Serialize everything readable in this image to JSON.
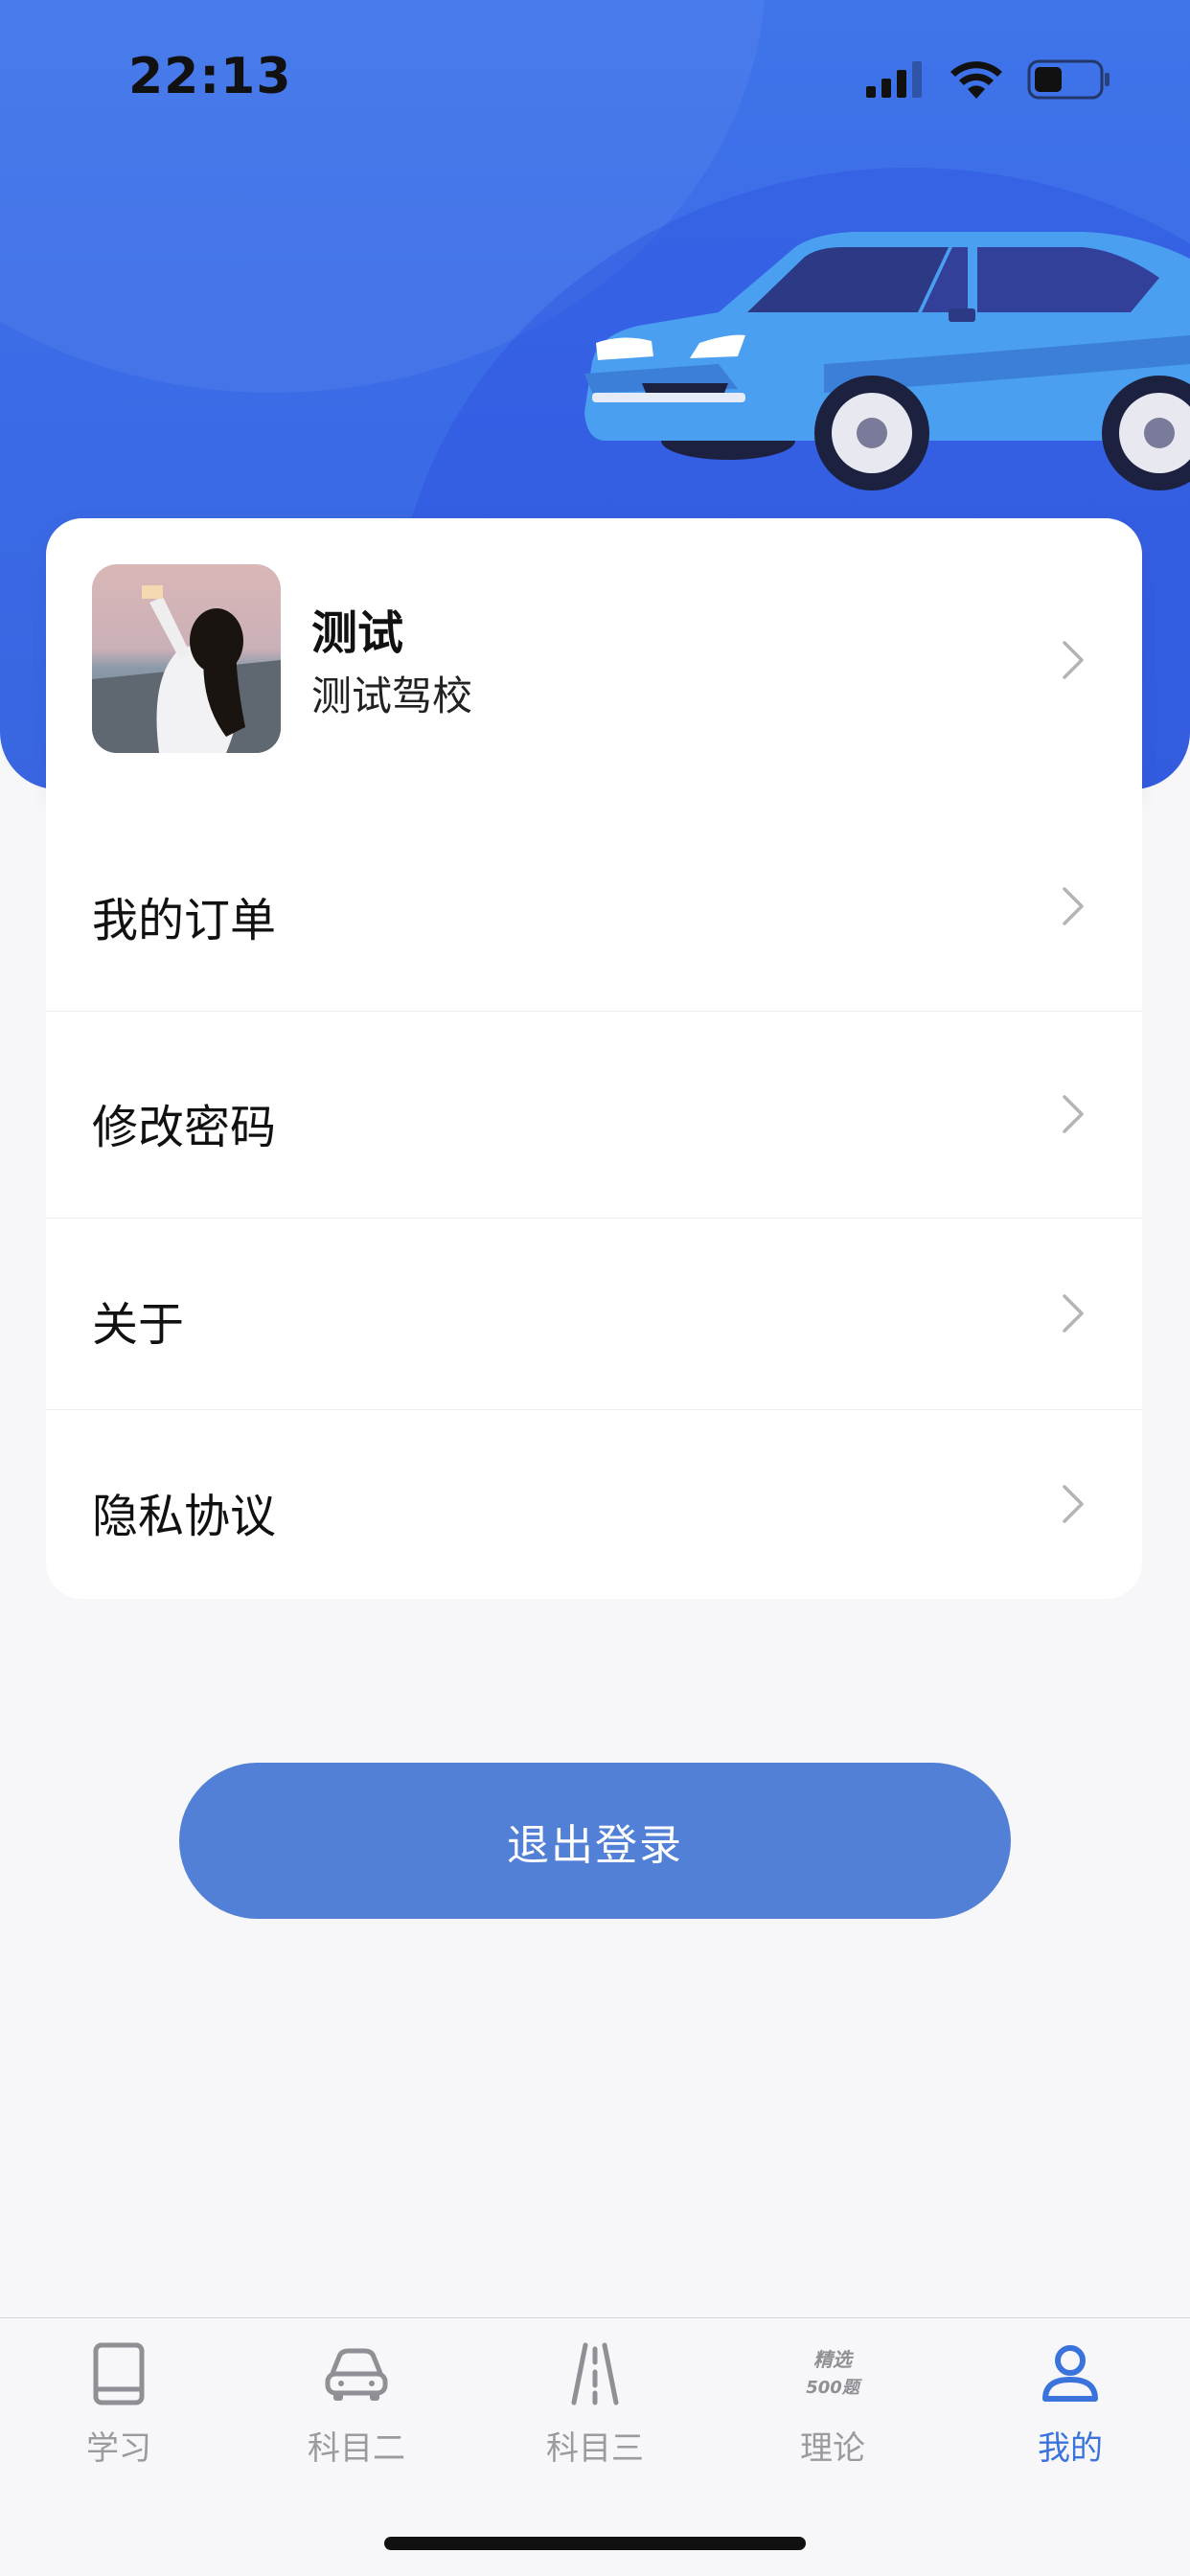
{
  "status_bar": {
    "time": "22:13"
  },
  "profile": {
    "name": "测试",
    "school": "测试驾校"
  },
  "menu": [
    {
      "label": "我的订单"
    },
    {
      "label": "修改密码"
    },
    {
      "label": "关于"
    },
    {
      "label": "隐私协议"
    }
  ],
  "logout_label": "退出登录",
  "tabs": [
    {
      "label": "学习",
      "icon": "book-icon",
      "active": false
    },
    {
      "label": "科目二",
      "icon": "car-icon",
      "active": false
    },
    {
      "label": "科目三",
      "icon": "road-icon",
      "active": false
    },
    {
      "label": "理论",
      "icon": "badge-500-icon",
      "badge_line1": "精选",
      "badge_line2": "500题",
      "active": false
    },
    {
      "label": "我的",
      "icon": "user-icon",
      "active": true
    }
  ],
  "colors": {
    "header": "#3f74ea",
    "accent": "#3b73dc",
    "logout_button": "#5180d6",
    "tab_inactive": "#9a9aa0"
  }
}
